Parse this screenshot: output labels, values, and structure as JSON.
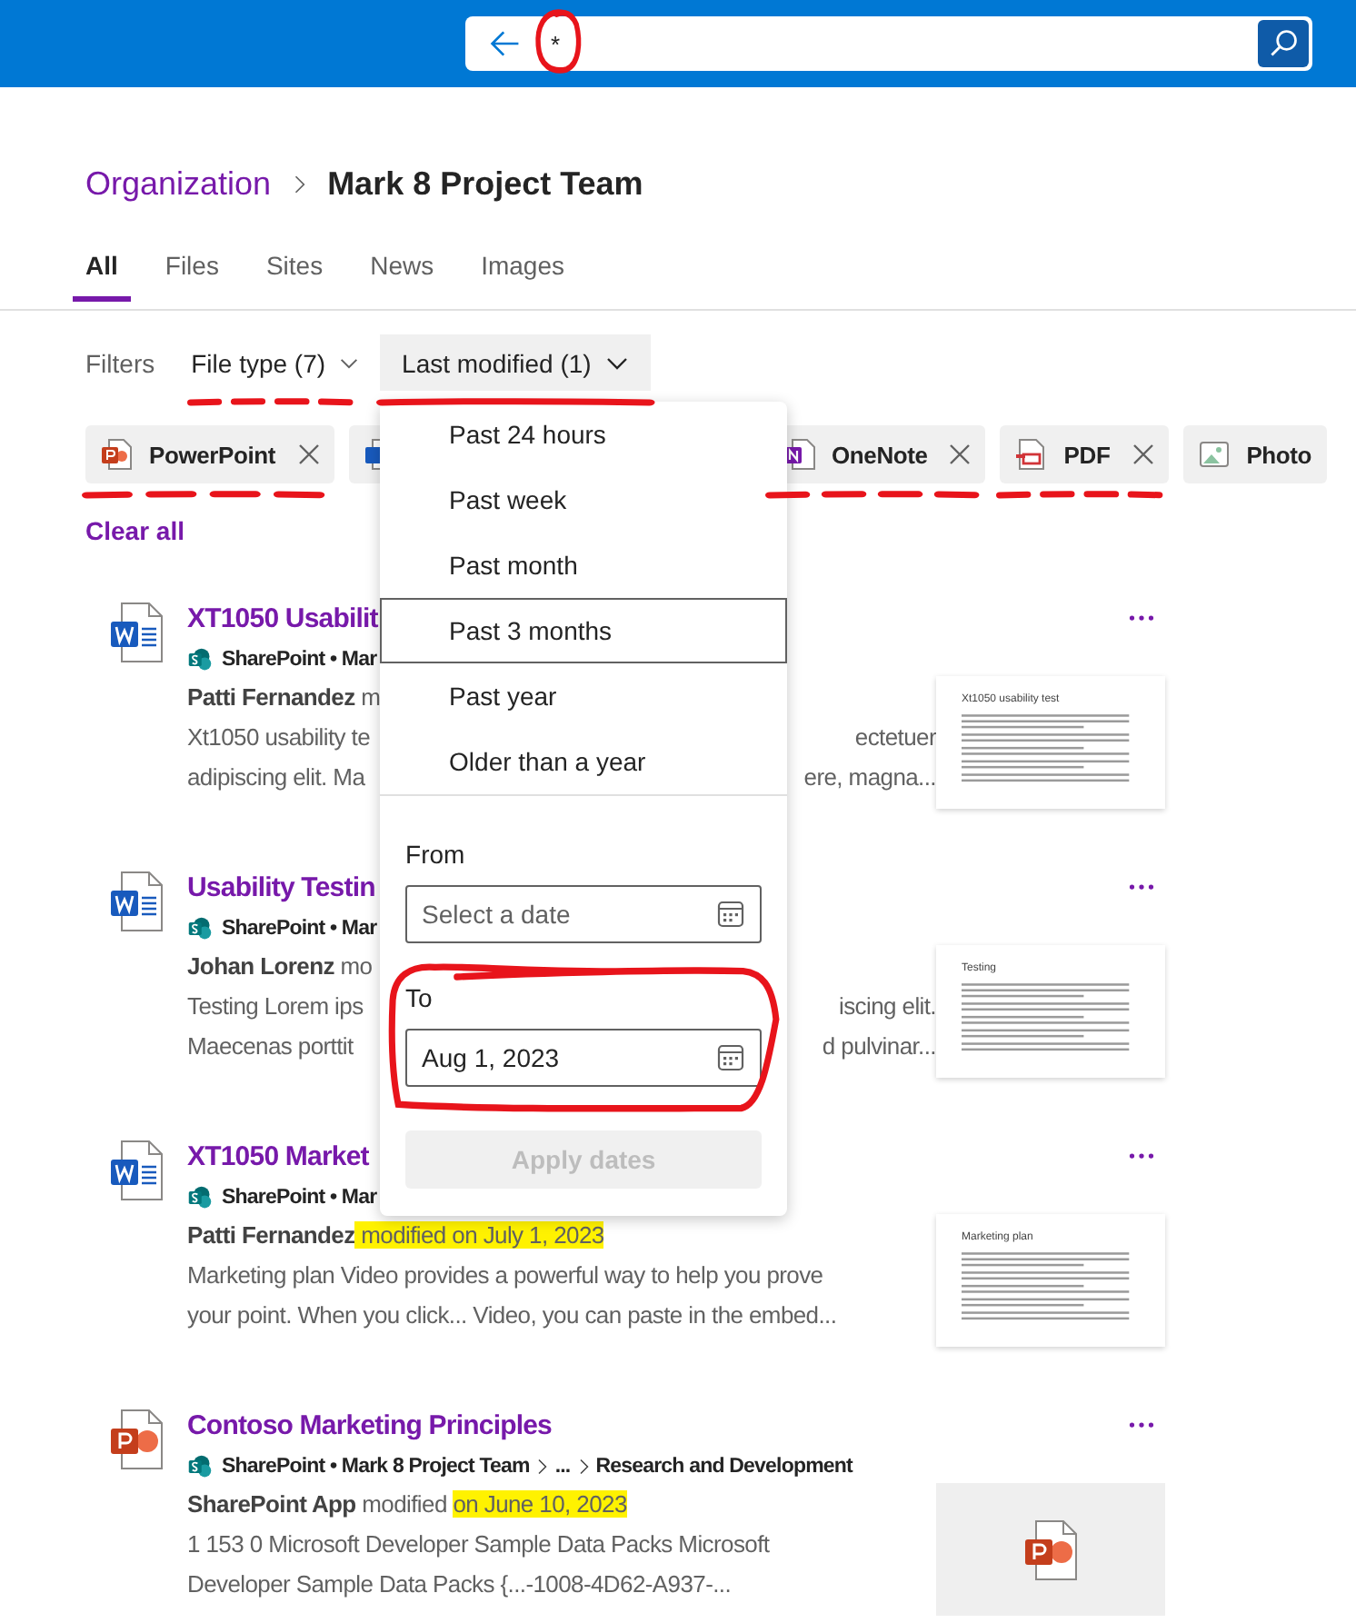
{
  "search": {
    "query": "*",
    "circled": true
  },
  "breadcrumb": [
    {
      "label": "Organization",
      "current": false
    },
    {
      "label": "Mark 8 Project Team",
      "current": true
    }
  ],
  "tabs": [
    {
      "label": "All",
      "selected": true
    },
    {
      "label": "Files",
      "selected": false
    },
    {
      "label": "Sites",
      "selected": false
    },
    {
      "label": "News",
      "selected": false
    },
    {
      "label": "Images",
      "selected": false
    }
  ],
  "filters": {
    "label": "Filters",
    "buttons": [
      {
        "label": "File type (7)",
        "open": false,
        "underlined": true,
        "dashed": true
      },
      {
        "label": "Last modified (1)",
        "open": true,
        "underlined": true,
        "dashed": false
      }
    ]
  },
  "chips": [
    {
      "kind": "powerpoint",
      "label": "PowerPoint",
      "removable": true,
      "underlined": true
    },
    {
      "kind": "word",
      "removable": false,
      "underlined": false
    },
    {
      "kind": "onenote",
      "label": "OneNote",
      "removable": true,
      "underlined": true
    },
    {
      "kind": "pdf",
      "label": "PDF",
      "removable": true,
      "underlined": true
    },
    {
      "kind": "photo",
      "label": "Photo",
      "removable": false,
      "underlined": false
    }
  ],
  "clear_all": "Clear all",
  "date_menu": {
    "options": [
      {
        "label": "Past 24 hours",
        "selected": false
      },
      {
        "label": "Past week",
        "selected": false
      },
      {
        "label": "Past month",
        "selected": false
      },
      {
        "label": "Past 3 months",
        "selected": true
      },
      {
        "label": "Past year",
        "selected": false
      },
      {
        "label": "Older than a year",
        "selected": false
      }
    ],
    "from": {
      "label": "From",
      "placeholder": "Select a date"
    },
    "to": {
      "label": "To",
      "value": "Aug 1, 2023",
      "circled": true
    },
    "apply": {
      "label": "Apply dates",
      "disabled": true
    }
  },
  "results": [
    {
      "kind": "word",
      "title": "XT1050 Usabilit",
      "source": [
        "SharePoint • Mar"
      ],
      "byline": [
        {
          "text": "Patti Fernandez",
          "emphasis": true,
          "highlighted": false
        },
        {
          "text": " m",
          "emphasis": false,
          "highlighted": false
        }
      ],
      "description": [
        {
          "left": "Xt1050 usability te",
          "right": "ectetuer"
        },
        {
          "left": "adipiscing elit. Ma",
          "right": "ere, magna..."
        }
      ],
      "thumbnail": {
        "kind": "document",
        "heading": "Xt1050 usability test"
      }
    },
    {
      "kind": "word",
      "title": "Usability Testin",
      "source": [
        "SharePoint • Mar"
      ],
      "byline": [
        {
          "text": "Johan Lorenz",
          "emphasis": true,
          "highlighted": false
        },
        {
          "text": " mo",
          "emphasis": false,
          "highlighted": false
        }
      ],
      "description": [
        {
          "left": "Testing Lorem ips",
          "right": "iscing elit."
        },
        {
          "left": "Maecenas porttit",
          "right": "d pulvinar..."
        }
      ],
      "thumbnail": {
        "kind": "document",
        "heading": "Testing"
      }
    },
    {
      "kind": "word",
      "title": "XT1050 Market",
      "source": [
        "SharePoint • Mar"
      ],
      "byline": [
        {
          "text": "Patti Fernandez",
          "emphasis": true,
          "highlighted": false
        },
        {
          "text": " modified on July 1, 2023",
          "emphasis": false,
          "highlighted": true
        }
      ],
      "description": [
        {
          "left": "Marketing plan Video provides a powerful way to help you prove"
        },
        {
          "left": "your point. When you click... Video, you can paste in the embed..."
        }
      ],
      "thumbnail": {
        "kind": "document",
        "heading": "Marketing plan"
      }
    },
    {
      "kind": "powerpoint",
      "title": "Contoso Marketing Principles",
      "source": [
        "SharePoint • Mark 8 Project Team",
        "...",
        "Research and Development"
      ],
      "byline": [
        {
          "text": "SharePoint App",
          "emphasis": true,
          "highlighted": false
        },
        {
          "text": " modified ",
          "emphasis": false,
          "highlighted": false
        },
        {
          "text": "on June 10, 2023",
          "emphasis": false,
          "highlighted": true
        }
      ],
      "description": [
        {
          "left": "1 153 0 Microsoft Developer Sample Data Packs Microsoft"
        },
        {
          "left": "Developer Sample Data Packs {...-1008-4D62-A937-..."
        }
      ],
      "thumbnail": {
        "kind": "slides"
      }
    }
  ]
}
